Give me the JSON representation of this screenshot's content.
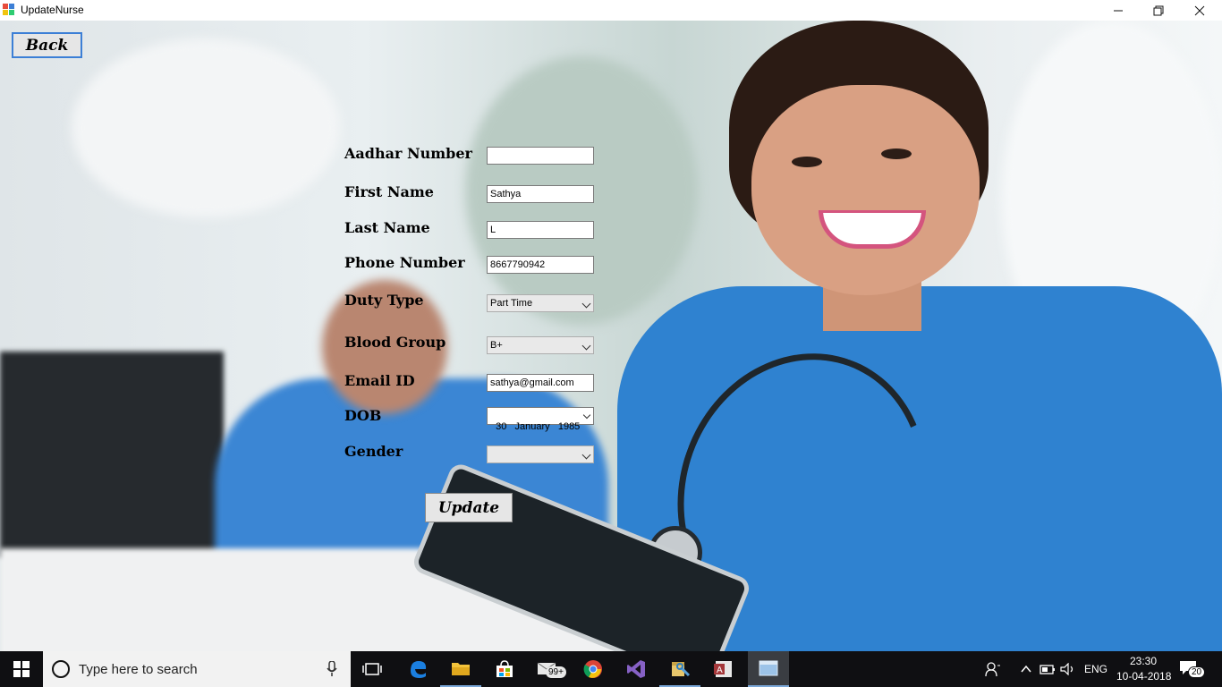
{
  "window": {
    "title": "UpdateNurse"
  },
  "nav": {
    "back_label": "Back"
  },
  "form": {
    "aadhar_label": "Aadhar Number",
    "aadhar_value": "",
    "first_name_label": "First Name",
    "first_name_value": "Sathya",
    "last_name_label": "Last Name",
    "last_name_value": "L",
    "phone_label": "Phone Number",
    "phone_value": "8667790942",
    "duty_type_label": "Duty Type",
    "duty_type_value": "Part Time",
    "blood_group_label": "Blood Group",
    "blood_group_value": "B+",
    "email_label": "Email ID",
    "email_value": "sathya@gmail.com",
    "dob_label": "DOB",
    "dob_value": "30   January   1985",
    "gender_label": "Gender",
    "gender_value": "",
    "update_label": "Update"
  },
  "taskbar": {
    "search_placeholder": "Type here to search",
    "mail_badge": "99+",
    "language": "ENG",
    "time": "23:30",
    "date": "10-04-2018",
    "notification_count": "20"
  },
  "icons": {
    "start": "windows-icon",
    "search": "cortana-circle-icon",
    "mic": "microphone-icon",
    "taskview": "task-view-icon",
    "edge": "edge-icon",
    "explorer": "folder-icon",
    "store": "store-icon",
    "mail": "mail-icon",
    "chrome": "chrome-icon",
    "vs": "visual-studio-icon",
    "tools": "tools-icon",
    "access": "access-icon",
    "window": "window-icon"
  },
  "colors": {
    "taskbar_bg": "#0f0f12",
    "scrubs_blue": "#2f82d0",
    "back_border": "#3c7fd6"
  }
}
